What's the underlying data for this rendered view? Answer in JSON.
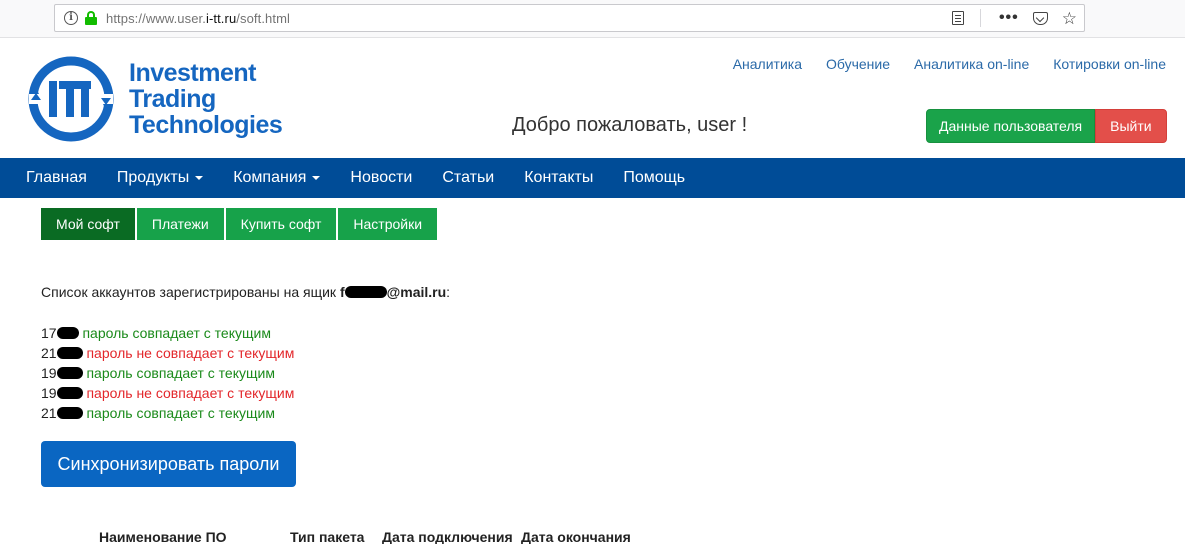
{
  "browser": {
    "url_prefix": "https://www.user.",
    "url_domain": "i-tt.ru",
    "url_path": "/soft.html",
    "icons": [
      "info-icon",
      "lock-icon",
      "reader-icon",
      "more-icon",
      "pocket-icon",
      "star-icon"
    ]
  },
  "brand": {
    "line1": "Investment",
    "line2": "Trading",
    "line3": "Technologies",
    "logo_letters": "ITT",
    "color": "#1566c0"
  },
  "top_links": [
    "Аналитика",
    "Обучение",
    "Аналитика on-line",
    "Котировки on-line"
  ],
  "welcome": "Добро пожаловать, user !",
  "user_buttons": {
    "profile": "Данные пользователя",
    "logout": "Выйти"
  },
  "nav": [
    {
      "label": "Главная",
      "dropdown": false
    },
    {
      "label": "Продукты",
      "dropdown": true
    },
    {
      "label": "Компания",
      "dropdown": true
    },
    {
      "label": "Новости",
      "dropdown": false
    },
    {
      "label": "Статьи",
      "dropdown": false
    },
    {
      "label": "Контакты",
      "dropdown": false
    },
    {
      "label": "Помощь",
      "dropdown": false
    }
  ],
  "tabs": [
    {
      "label": "Мой софт",
      "active": true
    },
    {
      "label": "Платежи",
      "active": false
    },
    {
      "label": "Купить софт",
      "active": false
    },
    {
      "label": "Настройки",
      "active": false
    }
  ],
  "accounts": {
    "title": "Список аккаунтов зарегистрированы на ящик ",
    "mail_prefix": "f",
    "mail_suffix": "@mail.ru",
    "colon": ":",
    "items": [
      {
        "prefix": "17",
        "status": "пароль совпадает с текущим",
        "match": true
      },
      {
        "prefix": "21",
        "status": "пароль не совпадает с текущим",
        "match": false
      },
      {
        "prefix": "19",
        "status": "пароль совпадает с текущим",
        "match": true
      },
      {
        "prefix": "19",
        "status": "пароль не совпадает с текущим",
        "match": false
      },
      {
        "prefix": "21",
        "status": "пароль совпадает с текущим",
        "match": true
      }
    ]
  },
  "sync_button": "Синхронизировать пароли",
  "table_headers": [
    "Наименование ПО",
    "Тип пакета",
    "Дата подключения",
    "Дата окончания"
  ]
}
